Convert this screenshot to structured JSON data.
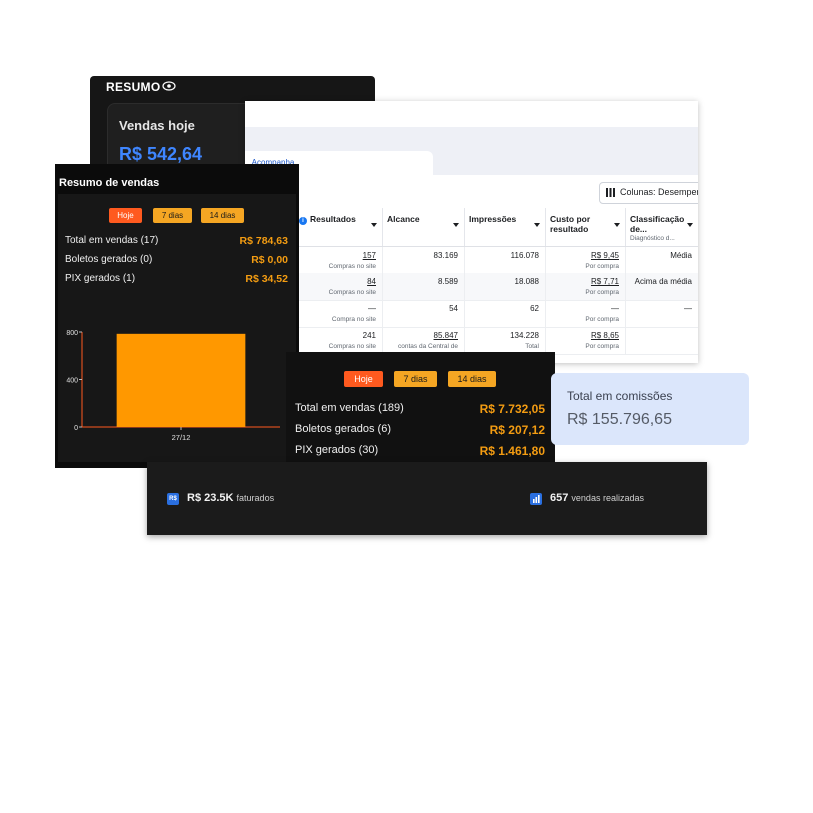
{
  "resumo": {
    "title": "RESUMO",
    "eye_icon": "eye-icon",
    "vendas_hoje_label": "Vendas hoje",
    "vendas_hoje_value": "R$ 542,64"
  },
  "ads": {
    "tab_label": "...Acompanha",
    "columns_button": "Colunas: Desempenh",
    "headers": [
      {
        "label": "Resultados",
        "sub": ""
      },
      {
        "label": "Alcance",
        "sub": ""
      },
      {
        "label": "Impressões",
        "sub": ""
      },
      {
        "label": "Custo por resultado",
        "sub": ""
      },
      {
        "label": "Classificação de...",
        "sub": "Diagnóstico d..."
      }
    ],
    "rows": [
      {
        "resultados": "157",
        "resultados_sub": "Compras no site",
        "alcance": "83.169",
        "alcance_sub": "",
        "impressoes": "116.078",
        "impressoes_sub": "",
        "custo": "R$ 9,45",
        "custo_sub": "Por compra",
        "classif": "Média"
      },
      {
        "resultados": "84",
        "resultados_sub": "Compras no site",
        "alcance": "8.589",
        "alcance_sub": "",
        "impressoes": "18.088",
        "impressoes_sub": "",
        "custo": "R$ 7,71",
        "custo_sub": "Por compra",
        "classif": "Acima da média"
      },
      {
        "resultados": "—",
        "resultados_sub": "Compra no site",
        "alcance": "54",
        "alcance_sub": "",
        "impressoes": "62",
        "impressoes_sub": "",
        "custo": "—",
        "custo_sub": "Por compra",
        "classif": "—"
      },
      {
        "resultados": "241",
        "resultados_sub": "Compras no site",
        "alcance": "85.847",
        "alcance_sub": "contas da Central de",
        "impressoes": "134.228",
        "impressoes_sub": "Total",
        "custo": "R$ 8,65",
        "custo_sub": "Por compra",
        "classif": ""
      }
    ]
  },
  "resumo_vendas": {
    "title": "Resumo de vendas",
    "pills": [
      "Hoje",
      "7 dias",
      "14 dias"
    ],
    "lines": [
      {
        "label": "Total em vendas (17)",
        "value": "R$ 784,63"
      },
      {
        "label": "Boletos gerados (0)",
        "value": "R$ 0,00"
      },
      {
        "label": "PIX gerados (1)",
        "value": "R$ 34,52"
      }
    ]
  },
  "chart_data": {
    "type": "bar",
    "categories": [
      "27/12"
    ],
    "values": [
      784.63
    ],
    "title": "",
    "xlabel": "",
    "ylabel": "",
    "ylim": [
      0,
      800
    ],
    "yticks": [
      0,
      400,
      800
    ],
    "grid": false,
    "bar_color": "#ff9800",
    "axis_color": "#ff5a1f"
  },
  "resumo_vendas_2": {
    "pills": [
      "Hoje",
      "7 dias",
      "14 dias"
    ],
    "lines": [
      {
        "label": "Total em vendas (189)",
        "value": "R$ 7.732,05"
      },
      {
        "label": "Boletos gerados (6)",
        "value": "R$ 207,12"
      },
      {
        "label": "PIX gerados (30)",
        "value": "R$ 1.461,80"
      }
    ]
  },
  "comissoes": {
    "label": "Total em comissões",
    "value": "R$ 155.796,65"
  },
  "stats": {
    "faturado_icon": "R$",
    "faturado_value": "R$ 23.5K",
    "faturado_label": "faturados",
    "vendas_icon": "chart-icon",
    "vendas_value": "657",
    "vendas_label": "vendas realizadas"
  },
  "colors": {
    "accent_orange": "#f39c12",
    "active_pill": "#ff5a1f",
    "blue_value": "#3f86ff",
    "commission_bg": "#dbe6fb"
  }
}
